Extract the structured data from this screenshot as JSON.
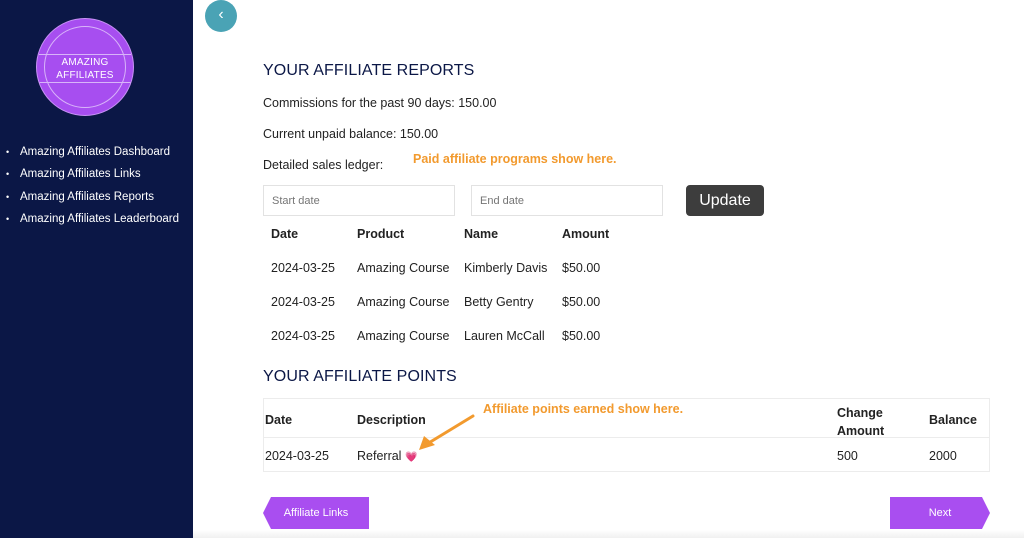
{
  "sidebar": {
    "logo": {
      "line1": "AMAZING",
      "line2": "AFFILIATES"
    },
    "items": [
      {
        "label": "Amazing Affiliates Dashboard"
      },
      {
        "label": "Amazing Affiliates Links"
      },
      {
        "label": "Amazing Affiliates Reports"
      },
      {
        "label": "Amazing Affiliates Leaderboard"
      }
    ]
  },
  "back_button": {
    "icon": "chevron-left-icon",
    "glyph": "‹"
  },
  "reports": {
    "title": "YOUR AFFILIATE REPORTS",
    "commissions": "Commissions for the past 90 days: 150.00",
    "balance": "Current unpaid balance: 150.00",
    "ledger_label": "Detailed sales ledger:",
    "annotation": "Paid affiliate programs show here.",
    "start_placeholder": "Start date",
    "end_placeholder": "End date",
    "update_label": "Update",
    "columns": [
      "Date",
      "Product",
      "Name",
      "Amount"
    ],
    "rows": [
      [
        "2024-03-25",
        "Amazing Course",
        "Kimberly Davis",
        "$50.00"
      ],
      [
        "2024-03-25",
        "Amazing Course",
        "Betty Gentry",
        "$50.00"
      ],
      [
        "2024-03-25",
        "Amazing Course",
        "Lauren McCall",
        "$50.00"
      ]
    ]
  },
  "points": {
    "title": "YOUR AFFILIATE POINTS",
    "annotation": "Affiliate points earned show here.",
    "columns": [
      "Date",
      "Description",
      "Change\nAmount",
      "Balance"
    ],
    "rows": [
      {
        "date": "2024-03-25",
        "description": "Referral",
        "emoji": "💗",
        "change": "500",
        "balance": "2000"
      }
    ]
  },
  "footer": {
    "prev_label": "Affiliate Links",
    "next_label": "Next"
  },
  "colors": {
    "sidebar": "#0b1746",
    "accent": "#a94ef0",
    "annotation": "#f29a2e",
    "back_button": "#4aa3b5"
  }
}
